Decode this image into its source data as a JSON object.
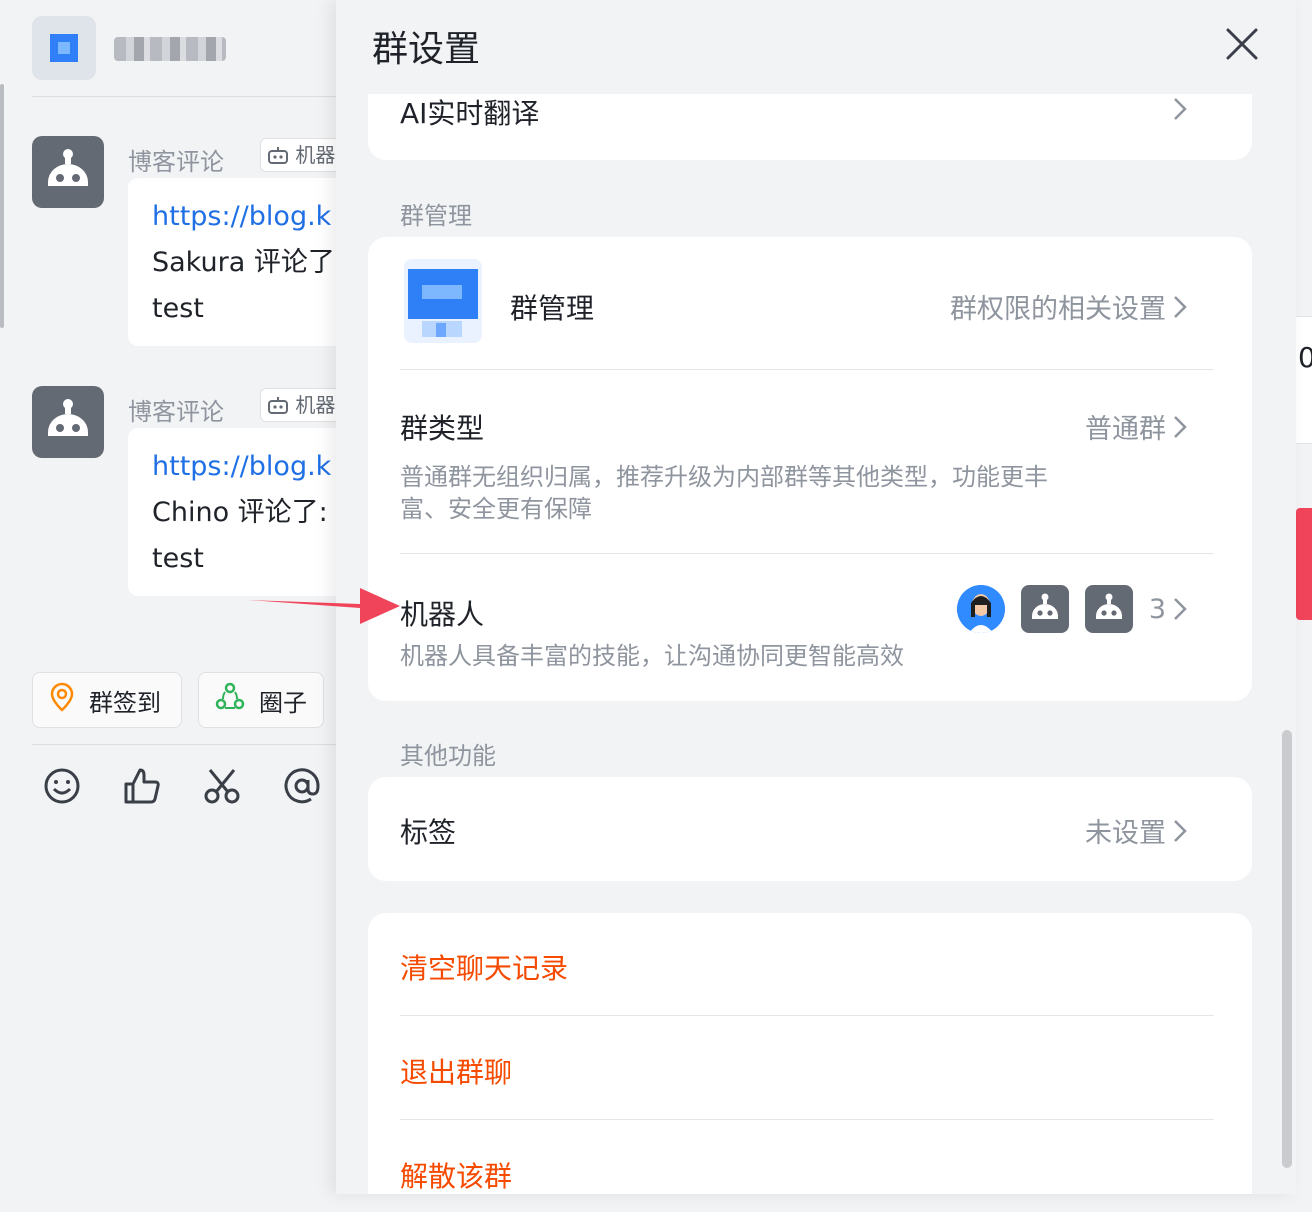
{
  "chat": {
    "messages": [
      {
        "sender": "博客评论",
        "tag": "机器人",
        "link": "https://blog.k",
        "line2": "Sakura 评论了",
        "line3": "test"
      },
      {
        "sender": "博客评论",
        "tag": "机器人",
        "link": "https://blog.k",
        "line2": "Chino 评论了:",
        "line3": "test"
      }
    ],
    "quick_actions": {
      "checkin": "群签到",
      "circle": "圈子"
    },
    "toolbar_icons": [
      "emoji-icon",
      "thumbs-up-icon",
      "scissors-icon",
      "at-icon"
    ]
  },
  "panel": {
    "title": "群设置",
    "ai_translate": "AI实时翻译",
    "group_manage_section": "群管理",
    "group_manage": {
      "title": "群管理",
      "hint": "群权限的相关设置"
    },
    "group_type": {
      "title": "群类型",
      "value": "普通群",
      "desc_line1": "普通群无组织归属，推荐升级为内部群等其他类型，功能更丰",
      "desc_line2": "富、安全更有保障"
    },
    "robots": {
      "title": "机器人",
      "desc": "机器人具备丰富的技能，让沟通协同更智能高效",
      "count": "3"
    },
    "other_section": "其他功能",
    "tags": {
      "title": "标签",
      "value": "未设置"
    },
    "danger": {
      "clear": "清空聊天记录",
      "leave": "退出群聊",
      "dissolve": "解散该群"
    }
  },
  "colors": {
    "danger": "#f54a00",
    "link": "#1f6fe5",
    "arrow": "#f0445a",
    "bot_avatar": "#646a73"
  }
}
